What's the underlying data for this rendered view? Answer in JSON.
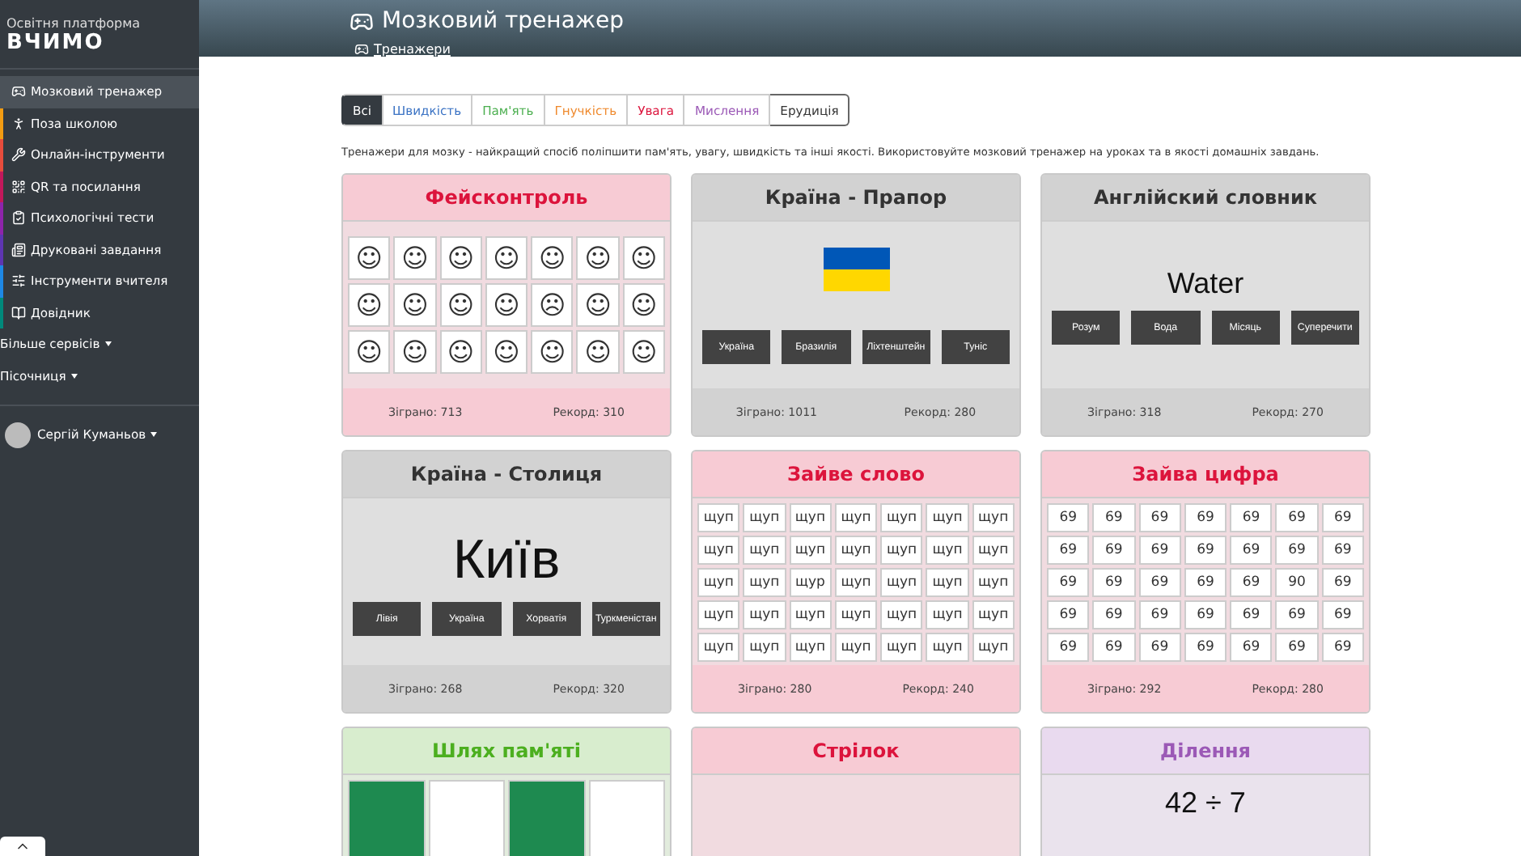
{
  "brand": {
    "subtitle": "Освітня платформа",
    "name": "ВЧИМО"
  },
  "sidebar": {
    "items": [
      {
        "label": "Мозковий тренажер",
        "selected": true
      },
      {
        "label": "Поза школою",
        "selected": false,
        "color": "#f39c12"
      },
      {
        "label": "Онлайн-інструменти",
        "selected": false,
        "color": "#e74c3c"
      },
      {
        "label": "QR та посилання",
        "selected": false,
        "color": "#c2185b"
      },
      {
        "label": "Психологічні тести",
        "selected": false,
        "color": "#8e24aa"
      },
      {
        "label": "Друковані завдання",
        "selected": false,
        "color": "#5e35b1"
      },
      {
        "label": "Інструменти вчителя",
        "selected": false,
        "color": "#1e88e5"
      },
      {
        "label": "Довідник",
        "selected": false,
        "color": "#00897b"
      }
    ],
    "menus": [
      "Більше сервісів",
      "Пісочниця"
    ],
    "user": "Сергій Куманьов"
  },
  "header": {
    "title": "Мозковий тренажер",
    "breadcrumb": "Тренажери"
  },
  "filters": [
    {
      "label": "Всі",
      "selected": true,
      "color": "#343a40"
    },
    {
      "label": "Швидкість",
      "selected": false,
      "color": "#3b73c4"
    },
    {
      "label": "Пам'ять",
      "selected": false,
      "color": "#4caf50"
    },
    {
      "label": "Гнучкість",
      "selected": false,
      "color": "#ef8a2e"
    },
    {
      "label": "Увага",
      "selected": false,
      "color": "#dc143c"
    },
    {
      "label": "Мислення",
      "selected": false,
      "color": "#9b59b6"
    },
    {
      "label": "Ерудиція",
      "selected": false,
      "color": "#333333"
    }
  ],
  "description": "Тренажери для мозку - найкращий спосіб поліпшити пам'ять, увагу, швидкість та інші якості. Використовуйте мозковий тренажер на уроках та в якості домашніх завдань.",
  "cards": [
    {
      "title": "Фейсконтроль",
      "color": "#dc143c",
      "kind": "grid",
      "cells": [
        "☺",
        "☺",
        "☺",
        "☺",
        "☺",
        "☺",
        "☺",
        "☺",
        "☺",
        "☺",
        "☺",
        "☹",
        "☺",
        "☺",
        "☺",
        "☺",
        "☺",
        "☺",
        "☺",
        "☺",
        "☺"
      ],
      "played": "Зіграно: 713",
      "record": "Рекорд: 310"
    },
    {
      "title": "Країна - Прапор",
      "color": "#333333",
      "kind": "flag",
      "options": [
        "Україна",
        "Бразилія",
        "Ліхтенштейн",
        "Туніс"
      ],
      "played": "Зіграно: 1011",
      "record": "Рекорд: 280"
    },
    {
      "title": "Англійский словник",
      "color": "#333333",
      "kind": "word",
      "word": "Water",
      "options": [
        "Розум",
        "Вода",
        "Місяць",
        "Суперечити"
      ],
      "played": "Зіграно: 318",
      "record": "Рекорд: 270"
    },
    {
      "title": "Країна - Столиця",
      "color": "#333333",
      "kind": "word",
      "word": "Київ",
      "options": [
        "Лівія",
        "Україна",
        "Хорватія",
        "Туркменістан"
      ],
      "played": "Зіграно: 268",
      "record": "Рекорд: 320"
    },
    {
      "title": "Зайве слово",
      "color": "#dc143c",
      "kind": "grid",
      "cells": [
        "щуп",
        "щуп",
        "щуп",
        "щуп",
        "щуп",
        "щуп",
        "щуп",
        "щуп",
        "щуп",
        "щуп",
        "щуп",
        "щуп",
        "щуп",
        "щуп",
        "щуп",
        "щуп",
        "щур",
        "щуп",
        "щуп",
        "щуп",
        "щуп",
        "щуп",
        "щуп",
        "щуп",
        "щуп",
        "щуп",
        "щуп",
        "щуп",
        "щуп",
        "щуп",
        "щуп",
        "щуп",
        "щуп",
        "щуп",
        "щуп"
      ],
      "played": "Зіграно: 280",
      "record": "Рекорд: 240"
    },
    {
      "title": "Зайва цифра",
      "color": "#dc143c",
      "kind": "grid",
      "cells": [
        "69",
        "69",
        "69",
        "69",
        "69",
        "69",
        "69",
        "69",
        "69",
        "69",
        "69",
        "69",
        "69",
        "69",
        "69",
        "69",
        "69",
        "69",
        "69",
        "90",
        "69",
        "69",
        "69",
        "69",
        "69",
        "69",
        "69",
        "69",
        "69",
        "69",
        "69",
        "69",
        "69",
        "69",
        "69"
      ],
      "played": "Зіграно: 292",
      "record": "Рекорд: 280"
    },
    {
      "title": "Шлях пам'яті",
      "color": "#4caf1f",
      "kind": "tiles",
      "tiles": [
        {
          "filled": true
        },
        {
          "filled": false
        },
        {
          "filled": true
        },
        {
          "filled": false
        }
      ]
    },
    {
      "title": "Стрілок",
      "color": "#dc143c",
      "kind": "blank"
    },
    {
      "title": "Ділення",
      "color": "#9b59b6",
      "kind": "word",
      "word": "42 ÷ 7"
    }
  ]
}
